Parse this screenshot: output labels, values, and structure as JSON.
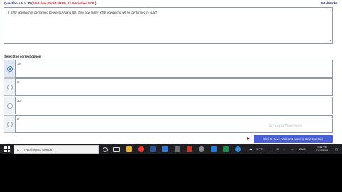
{
  "header": {
    "question_prefix": "Question # 5 of 10 (",
    "start_time_label": "Start time: 06:58:59 PM, 17 December 2021",
    "question_suffix": " )",
    "total_marks_label": "Total Marks: ",
    "total_marks_value": ""
  },
  "question": {
    "text": "If XNU operation is performed between AA and BB, then how many XNU operations will be performed in total?"
  },
  "select_label": "Select the correct option",
  "options": [
    {
      "text": "18",
      "selected": true
    },
    {
      "text": "6",
      "selected": false
    },
    {
      "text": "30",
      "selected": false
    },
    {
      "text": "2",
      "selected": false
    }
  ],
  "watermark": "Activate Windows",
  "save_button_label": "Click to Save Answer & Move to Next Question",
  "taskbar": {
    "search_placeholder": "Type here to search",
    "temperature": "17°C",
    "time": "6:51 PM",
    "date": "12/17/2021",
    "lang": "ENG"
  },
  "colors": {
    "header_blue": "#1b2a66",
    "header_red": "#d3232c",
    "button_blue": "#4a5fd6",
    "radio_blue": "#2f6fdc"
  }
}
